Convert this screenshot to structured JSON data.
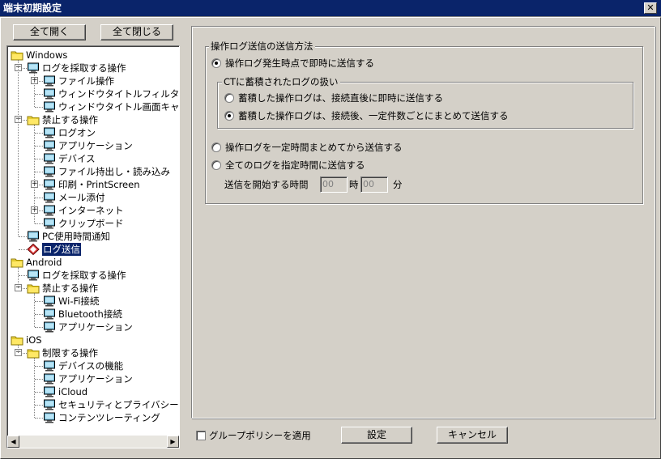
{
  "window": {
    "title": "端末初期設定",
    "close_label": "✕"
  },
  "toolbar": {
    "expand_all": "全て開く",
    "collapse_all": "全て閉じる"
  },
  "tree": [
    {
      "label": "Windows",
      "icon": "folder-icon",
      "level": 0,
      "expander": ""
    },
    {
      "label": "ログを採取する操作",
      "icon": "monitor-icon",
      "level": 1,
      "expander": "−"
    },
    {
      "label": "ファイル操作",
      "icon": "monitor-icon",
      "level": 2,
      "expander": "+"
    },
    {
      "label": "ウィンドウタイトルフィルタ",
      "icon": "monitor-icon",
      "level": 2,
      "expander": ""
    },
    {
      "label": "ウィンドウタイトル画面キャプチャ",
      "icon": "monitor-icon",
      "level": 2,
      "expander": ""
    },
    {
      "label": "禁止する操作",
      "icon": "folder-icon",
      "level": 1,
      "expander": "−"
    },
    {
      "label": "ログオン",
      "icon": "monitor-icon",
      "level": 2,
      "expander": ""
    },
    {
      "label": "アプリケーション",
      "icon": "monitor-icon",
      "level": 2,
      "expander": ""
    },
    {
      "label": "デバイス",
      "icon": "monitor-icon",
      "level": 2,
      "expander": ""
    },
    {
      "label": "ファイル持出し・読み込み",
      "icon": "monitor-icon",
      "level": 2,
      "expander": ""
    },
    {
      "label": "印刷・PrintScreen",
      "icon": "monitor-icon",
      "level": 2,
      "expander": "+"
    },
    {
      "label": "メール添付",
      "icon": "monitor-icon",
      "level": 2,
      "expander": ""
    },
    {
      "label": "インターネット",
      "icon": "monitor-icon",
      "level": 2,
      "expander": "+"
    },
    {
      "label": "クリップボード",
      "icon": "monitor-icon",
      "level": 2,
      "expander": ""
    },
    {
      "label": "PC使用時間通知",
      "icon": "monitor-icon",
      "level": 1,
      "expander": ""
    },
    {
      "label": "ログ送信",
      "icon": "diamond-icon",
      "level": 1,
      "expander": "",
      "selected": true
    },
    {
      "label": "Android",
      "icon": "folder-icon",
      "level": 0,
      "expander": ""
    },
    {
      "label": "ログを採取する操作",
      "icon": "monitor-icon",
      "level": 1,
      "expander": ""
    },
    {
      "label": "禁止する操作",
      "icon": "folder-icon",
      "level": 1,
      "expander": "−"
    },
    {
      "label": "Wi-Fi接続",
      "icon": "monitor-icon",
      "level": 2,
      "expander": ""
    },
    {
      "label": "Bluetooth接続",
      "icon": "monitor-icon",
      "level": 2,
      "expander": ""
    },
    {
      "label": "アプリケーション",
      "icon": "monitor-icon",
      "level": 2,
      "expander": ""
    },
    {
      "label": "iOS",
      "icon": "folder-icon",
      "level": 0,
      "expander": ""
    },
    {
      "label": "制限する操作",
      "icon": "folder-icon",
      "level": 1,
      "expander": "−"
    },
    {
      "label": "デバイスの機能",
      "icon": "monitor-icon",
      "level": 2,
      "expander": ""
    },
    {
      "label": "アプリケーション",
      "icon": "monitor-icon",
      "level": 2,
      "expander": ""
    },
    {
      "label": "iCloud",
      "icon": "monitor-icon",
      "level": 2,
      "expander": ""
    },
    {
      "label": "セキュリティとプライバシー",
      "icon": "monitor-icon",
      "level": 2,
      "expander": ""
    },
    {
      "label": "コンテンツレーティング",
      "icon": "monitor-icon",
      "level": 2,
      "expander": ""
    }
  ],
  "scrollbar": {
    "left_arrow": "◀",
    "right_arrow": "▶"
  },
  "send_method": {
    "title": "操作ログ送信の送信方法",
    "option_immediate": "操作ログ発生時点で即時に送信する",
    "ct_group": {
      "title": "CTに蓄積されたログの扱い",
      "option_on_connect": "蓄積した操作ログは、接続直後に即時に送信する",
      "option_batch": "蓄積した操作ログは、接続後、一定件数ごとにまとめて送信する"
    },
    "option_interval": "操作ログを一定時間まとめてから送信する",
    "option_scheduled": "全てのログを指定時間に送信する",
    "start_time_label": "送信を開始する時間",
    "hour_value": "00",
    "hour_unit": "時",
    "minute_value": "00",
    "minute_unit": "分"
  },
  "footer": {
    "group_policy_label": "グループポリシーを適用",
    "group_policy_checked": false,
    "ok_label": "設定",
    "cancel_label": "キャンセル"
  }
}
